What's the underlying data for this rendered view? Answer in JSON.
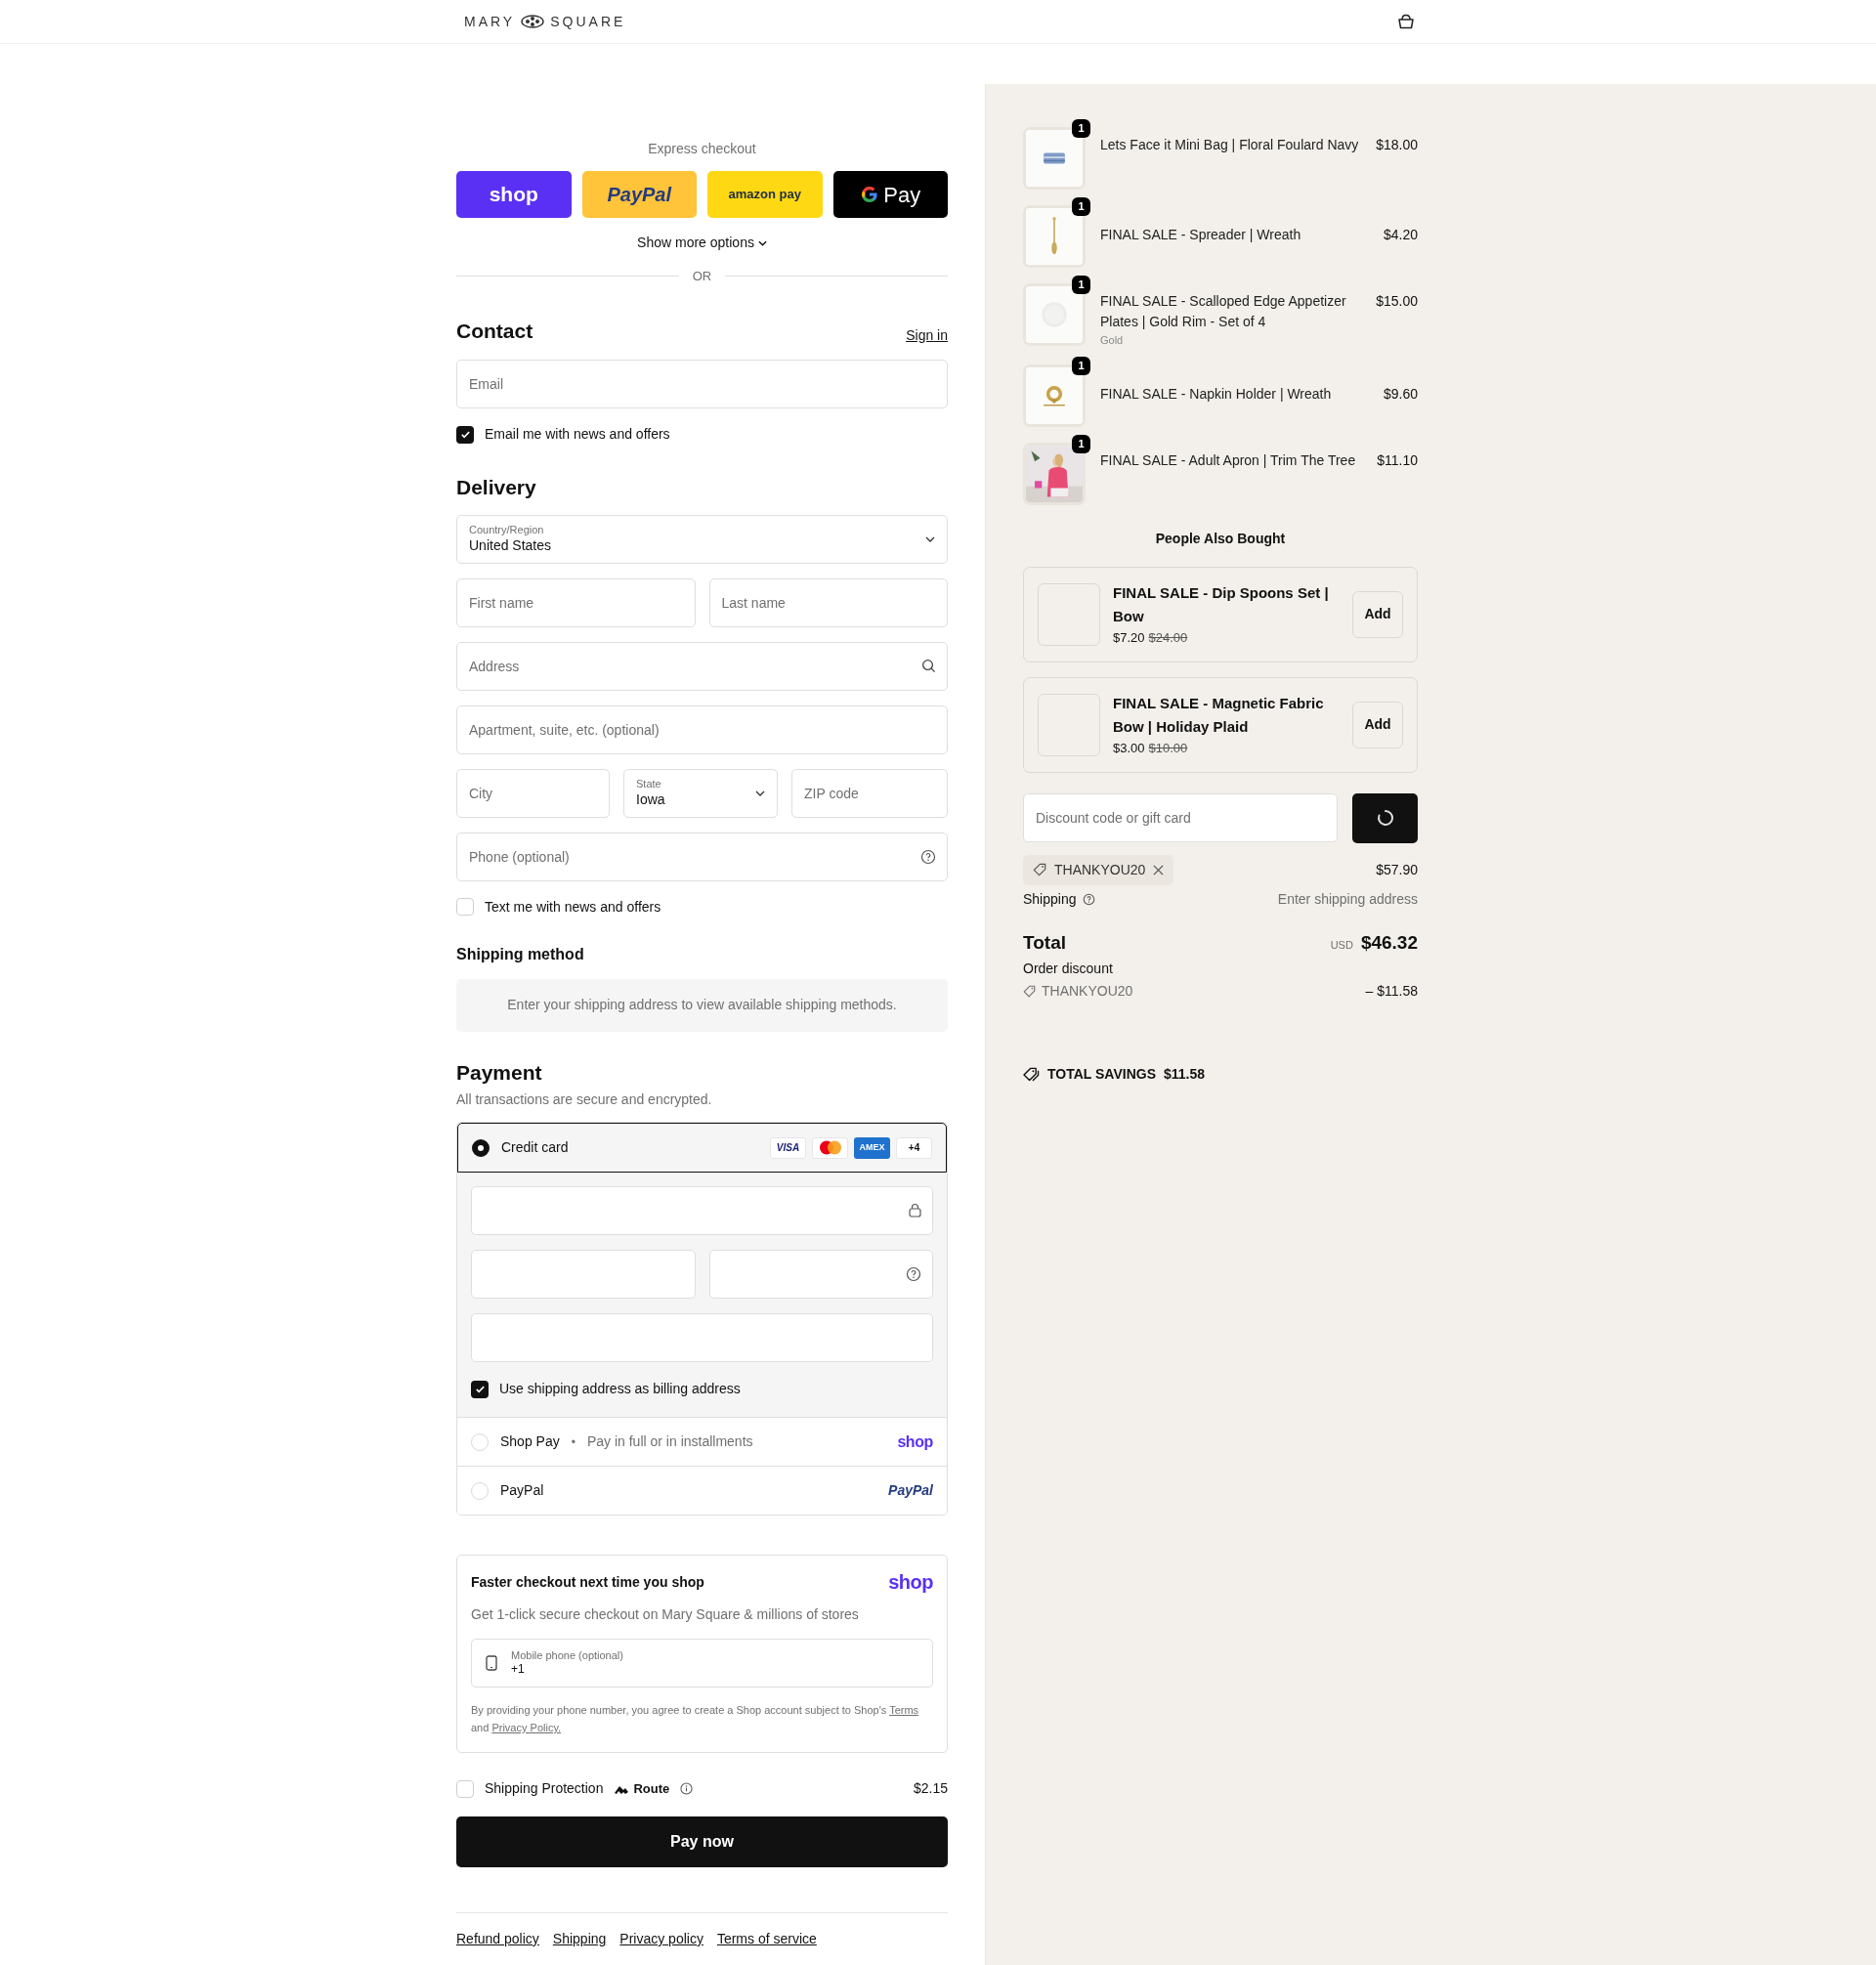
{
  "header": {
    "brand_left": "MARY",
    "brand_right": "SQUARE"
  },
  "express": {
    "label": "Express checkout",
    "buttons": [
      {
        "kind": "shop",
        "label": "shop"
      },
      {
        "kind": "paypal",
        "label": "PayPal"
      },
      {
        "kind": "amazon",
        "label": "amazon pay"
      },
      {
        "kind": "gpay",
        "label": "Pay"
      }
    ],
    "more": "Show more options",
    "divider": "OR"
  },
  "contact": {
    "title": "Contact",
    "sign_in": "Sign in",
    "email_placeholder": "Email",
    "news": {
      "label": "Email me with news and offers",
      "checked": true
    }
  },
  "delivery": {
    "title": "Delivery",
    "country": {
      "label": "Country/Region",
      "value": "United States"
    },
    "first_name": {
      "placeholder": "First name"
    },
    "last_name": {
      "placeholder": "Last name"
    },
    "address": {
      "placeholder": "Address"
    },
    "apartment": {
      "placeholder": "Apartment, suite, etc. (optional)"
    },
    "city": {
      "placeholder": "City"
    },
    "state": {
      "label": "State",
      "value": "Iowa"
    },
    "zip": {
      "placeholder": "ZIP code"
    },
    "phone": {
      "placeholder": "Phone (optional)"
    },
    "text_me": {
      "label": "Text me with news and offers",
      "checked": false
    }
  },
  "shipping_method": {
    "title": "Shipping method",
    "message": "Enter your shipping address to view available shipping methods."
  },
  "payment": {
    "title": "Payment",
    "subtitle": "All transactions are secure and encrypted.",
    "methods": [
      {
        "kind": "card",
        "label": "Credit card",
        "selected": true,
        "brands": [
          {
            "kind": "visa",
            "label": "VISA"
          },
          {
            "kind": "mastercard"
          },
          {
            "kind": "amex",
            "label": "AMEX"
          },
          {
            "kind": "more",
            "label": "+4"
          }
        ],
        "billing": {
          "label": "Use shipping address as billing address",
          "checked": true
        }
      },
      {
        "kind": "shoppay",
        "label": "Shop Pay",
        "separator": "•",
        "note": "Pay in full or in installments",
        "logo": "shop",
        "selected": false
      },
      {
        "kind": "paypal",
        "label": "PayPal",
        "logo": "PayPal",
        "selected": false
      }
    ]
  },
  "shop_promo": {
    "title": "Faster checkout next time you shop",
    "logo": "shop",
    "subtitle": "Get 1-click secure checkout on Mary Square & millions of stores",
    "phone": {
      "label": "Mobile phone (optional)",
      "value": "+1"
    },
    "legal": "By providing your phone number, you agree to create a Shop account subject to Shop's",
    "terms": "Terms",
    "and": "and",
    "privacy": "Privacy Policy."
  },
  "protection": {
    "label": "Shipping Protection",
    "brand": "Route",
    "price": "$2.15",
    "checked": false
  },
  "pay_button": "Pay now",
  "footer_links": [
    "Refund policy",
    "Shipping",
    "Privacy policy",
    "Terms of service"
  ],
  "summary": {
    "items": [
      {
        "quantity": "1",
        "name": "Lets Face it Mini Bag | Floral Foulard Navy",
        "price": "$18.00"
      },
      {
        "quantity": "1",
        "name": "FINAL SALE - Spreader | Wreath",
        "price": "$4.20"
      },
      {
        "quantity": "1",
        "name": "FINAL SALE - Scalloped Edge Appetizer Plates | Gold Rim - Set of 4",
        "variant": "Gold",
        "price": "$15.00"
      },
      {
        "quantity": "1",
        "name": "FINAL SALE - Napkin Holder | Wreath",
        "price": "$9.60"
      },
      {
        "quantity": "1",
        "name": "FINAL SALE - Adult Apron | Trim The Tree",
        "price": "$11.10"
      }
    ],
    "upsell": {
      "title": "People Also Bought",
      "products": [
        {
          "name": "FINAL SALE - Dip Spoons Set | Bow",
          "price": "$7.20",
          "compare_at": "$24.00",
          "button": "Add"
        },
        {
          "name": "FINAL SALE - Magnetic Fabric Bow | Holiday Plaid",
          "price": "$3.00",
          "compare_at": "$10.00",
          "button": "Add"
        }
      ]
    },
    "discount": {
      "placeholder": "Discount code or gift card",
      "loading": true
    },
    "applied_code": "THANKYOU20",
    "subtotal": "$57.90",
    "shipping": {
      "label": "Shipping",
      "value": "Enter shipping address"
    },
    "total": {
      "label": "Total",
      "currency": "USD",
      "amount": "$46.32"
    },
    "order_discount": {
      "label": "Order discount",
      "code": "THANKYOU20",
      "amount": "– $11.58"
    },
    "savings": {
      "label": "TOTAL SAVINGS",
      "amount": "$11.58"
    }
  }
}
